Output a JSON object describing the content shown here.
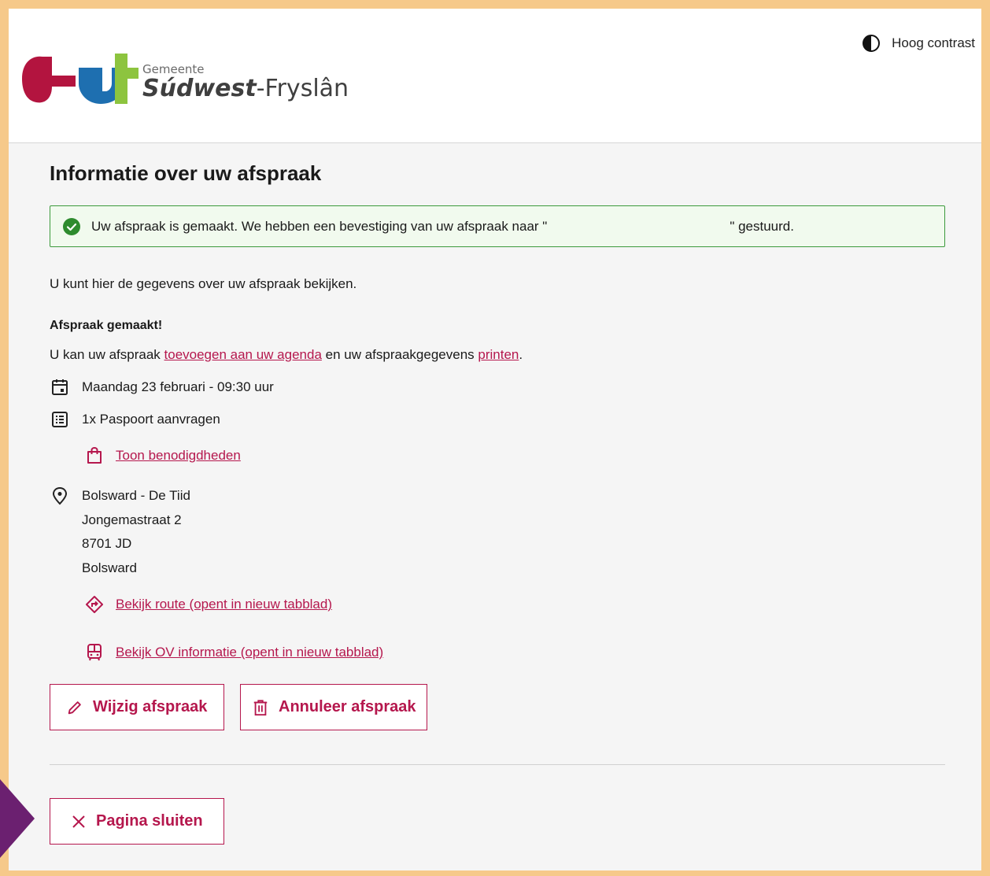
{
  "header": {
    "contrast_label": "Hoog contrast",
    "logo_sub": "Gemeente",
    "logo_name_bold": "Súdwest",
    "logo_name_rest": "-Fryslân"
  },
  "main": {
    "title": "Informatie over uw afspraak",
    "alert_before": "Uw afspraak is gemaakt. We hebben een bevestiging van uw afspraak naar \"",
    "alert_after": "\" gestuurd.",
    "intro": "U kunt hier de gegevens over uw afspraak bekijken.",
    "made_heading": "Afspraak gemaakt!",
    "agenda_prefix": "U kan uw afspraak ",
    "agenda_link": "toevoegen aan uw agenda",
    "agenda_middle": " en uw afspraakgegevens ",
    "print_link": "printen",
    "agenda_suffix": ".",
    "datetime": "Maandag 23 februari - 09:30 uur",
    "product": "1x Paspoort aanvragen",
    "requirements_link": "Toon benodigdheden",
    "location": {
      "name": "Bolsward - De Tiid",
      "street": "Jongemastraat 2",
      "postcode": "8701 JD",
      "city": "Bolsward"
    },
    "route_link": "Bekijk route (opent in nieuw tabblad)",
    "ov_link": "Bekijk OV informatie (opent in nieuw tabblad)",
    "edit_button": "Wijzig afspraak",
    "cancel_button": "Annuleer afspraak",
    "close_button": "Pagina sluiten"
  },
  "colors": {
    "accent": "#b5174d",
    "success": "#3c9a3c",
    "page_border": "#f6c98a",
    "marker": "#6b2070"
  }
}
